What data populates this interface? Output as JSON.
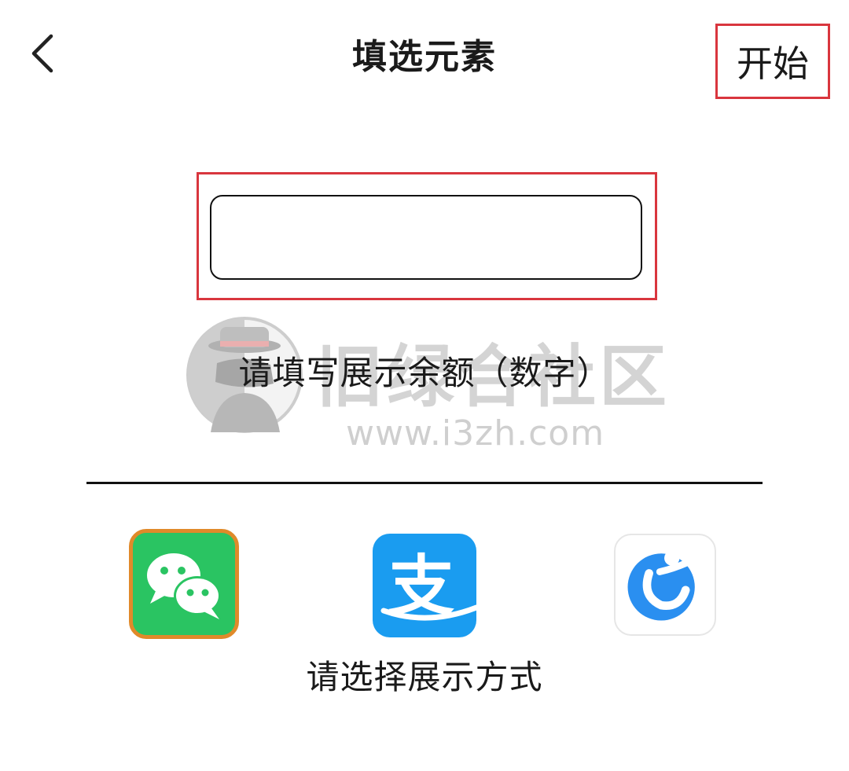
{
  "header": {
    "back_icon": "chevron-left-icon",
    "title": "填选元素",
    "start_label": "开始"
  },
  "amount": {
    "value": "",
    "placeholder": "",
    "caption": "请填写展示余额（数字）"
  },
  "watermark": {
    "logo_icon": "detective-logo-icon",
    "brand_text": "旧绿合社区",
    "url_text": "www.i3zh.com"
  },
  "methods": {
    "caption": "请选择展示方式",
    "items": [
      {
        "icon": "wechat-icon",
        "selected": true
      },
      {
        "icon": "alipay-icon",
        "alipay_glyph": "支",
        "selected": false
      },
      {
        "icon": "figure-app-icon",
        "selected": false
      }
    ]
  },
  "colors": {
    "highlight_border": "#d9363e",
    "selected_border": "#e08a2a",
    "wechat_green": "#2ac462",
    "alipay_blue": "#1a9cf0",
    "third_app_blue": "#2a8ff0"
  }
}
